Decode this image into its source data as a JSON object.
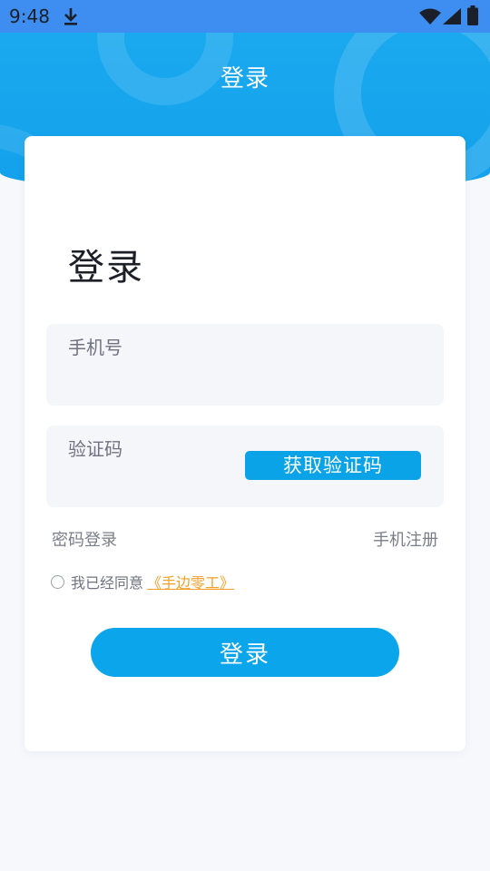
{
  "status_bar": {
    "time": "9:48",
    "icons": [
      "download-icon",
      "wifi-icon",
      "signal-icon",
      "battery-icon"
    ]
  },
  "header": {
    "title": "登录"
  },
  "form": {
    "title": "登录",
    "phone_placeholder": "手机号",
    "code_placeholder": "验证码",
    "get_code_label": "获取验证码",
    "password_login_link": "密码登录",
    "register_link": "手机注册",
    "agree_text": "我已经同意",
    "agreement_link": "《手边零工》",
    "login_button": "登录"
  },
  "colors": {
    "status_bar": "#3d8ef0",
    "header": "#13a1ec",
    "primary": "#0aa5ea",
    "agreement_link": "#f0a028",
    "background": "#f7f8fc"
  }
}
